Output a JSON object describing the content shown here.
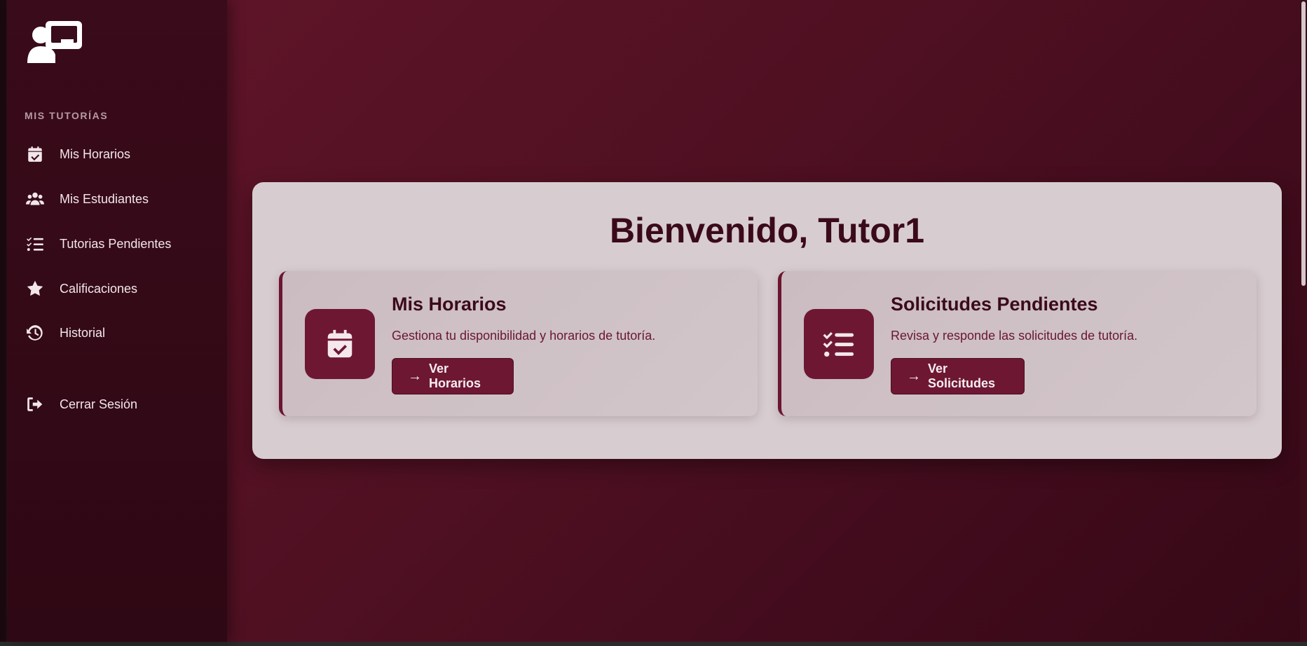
{
  "sidebar": {
    "section_title": "MIS TUTORÍAS",
    "items": [
      {
        "label": "Mis Horarios",
        "icon": "calendar-check-icon"
      },
      {
        "label": "Mis Estudiantes",
        "icon": "users-icon"
      },
      {
        "label": "Tutorias Pendientes",
        "icon": "list-check-icon"
      },
      {
        "label": "Calificaciones",
        "icon": "star-icon"
      },
      {
        "label": "Historial",
        "icon": "history-icon"
      }
    ],
    "logout": {
      "label": "Cerrar Sesión",
      "icon": "logout-icon"
    }
  },
  "main": {
    "welcome": "Bienvenido, Tutor1",
    "cards": [
      {
        "title": "Mis Horarios",
        "description": "Gestiona tu disponibilidad y horarios de tutoría.",
        "button": "Ver Horarios",
        "icon": "calendar-check-icon"
      },
      {
        "title": "Solicitudes Pendientes",
        "description": "Revisa y responde las solicitudes de tutoría.",
        "button": "Ver Solicitudes",
        "icon": "list-check-icon"
      }
    ]
  },
  "colors": {
    "accent": "#6e1733",
    "sidebar_bg": "#3a0b1a",
    "main_bg": "#4f1022",
    "panel_bg": "#d7cdd0"
  }
}
